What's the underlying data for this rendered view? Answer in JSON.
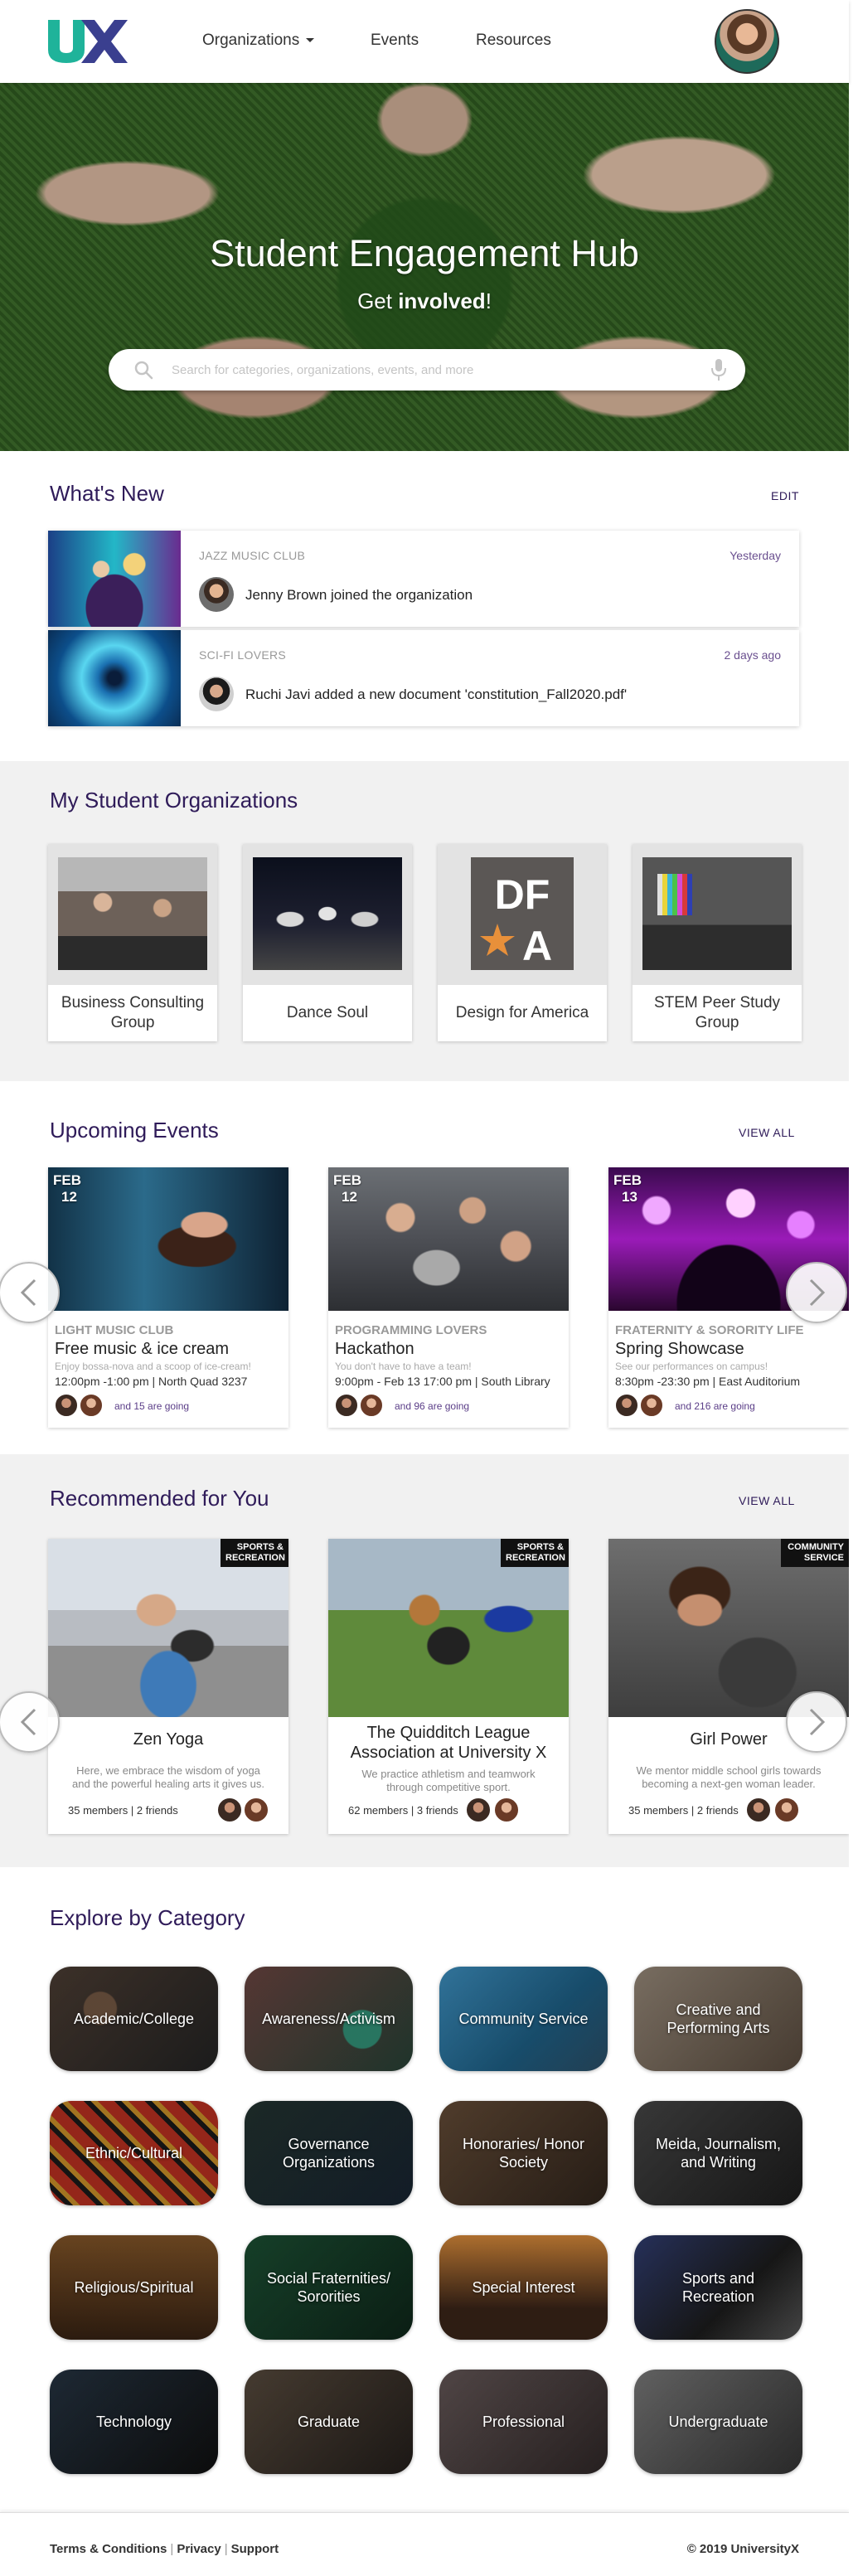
{
  "header": {
    "logo_text": "UX",
    "nav": {
      "organizations": "Organizations",
      "events": "Events",
      "resources": "Resources"
    }
  },
  "hero": {
    "title": "Student Engagement Hub",
    "subtitle_prefix": "Get ",
    "subtitle_bold": "involved",
    "subtitle_suffix": "!",
    "search_placeholder": "Search for categories, organizations, events, and more"
  },
  "whats_new": {
    "title": "What's New",
    "edit_label": "EDIT",
    "items": [
      {
        "club": "JAZZ MUSIC CLUB",
        "time": "Yesterday",
        "text": "Jenny Brown joined the organization"
      },
      {
        "club": "SCI-FI LOVERS",
        "time": "2 days ago",
        "text": "Ruchi Javi added a new document 'constitution_Fall2020.pdf'"
      }
    ]
  },
  "my_orgs": {
    "title": "My Student Organizations",
    "items": [
      {
        "name": "Business Consulting Group"
      },
      {
        "name": "Dance Soul"
      },
      {
        "name": "Design for America",
        "logo_text": "DF A"
      },
      {
        "name": "STEM Peer Study Group"
      }
    ]
  },
  "events": {
    "title": "Upcoming Events",
    "view_all": "VIEW ALL",
    "items": [
      {
        "month": "FEB",
        "day": "12",
        "club": "LIGHT MUSIC CLUB",
        "title": "Free music & ice cream",
        "desc": "Enjoy bossa-nova and a scoop of ice-cream!",
        "meta": "12:00pm -1:00 pm | North Quad 3237",
        "going": "and 15 are going"
      },
      {
        "month": "FEB",
        "day": "12",
        "club": "PROGRAMMING LOVERS",
        "title": "Hackathon",
        "desc": "You don't have to have a team!",
        "meta": "9:00pm - Feb 13 17:00 pm | South Library",
        "going": "and 96 are going"
      },
      {
        "month": "FEB",
        "day": "13",
        "club": "FRATERNITY & SORORITY LIFE",
        "title": "Spring Showcase",
        "desc": "See our performances on campus!",
        "meta": "8:30pm -23:30 pm | East Auditorium",
        "going": "and 216 are going"
      }
    ]
  },
  "recommended": {
    "title": "Recommended for You",
    "view_all": "VIEW ALL",
    "items": [
      {
        "tag_line1": "SPORTS &",
        "tag_line2": "RECREATION",
        "name": "Zen Yoga",
        "desc": "Here, we embrace the wisdom of yoga and the powerful healing arts it gives us.",
        "meta": "35 members | 2 friends"
      },
      {
        "tag_line1": "SPORTS &",
        "tag_line2": "RECREATION",
        "name": "The Quidditch League Association at University X",
        "desc": "We practice athletism and teamwork through competitive sport.",
        "meta": "62 members | 3 friends"
      },
      {
        "tag_line1": "COMMUNITY",
        "tag_line2": "SERVICE",
        "name": "Girl Power",
        "desc": "We mentor middle school girls towards becoming a next-gen woman leader.",
        "meta": "35 members | 2 friends"
      }
    ]
  },
  "categories": {
    "title": "Explore by Category",
    "items": [
      "Academic/College",
      "Awareness/Activism",
      "Community Service",
      "Creative and Performing Arts",
      "Ethnic/Cultural",
      "Governance Organizations",
      "Honoraries/ Honor Society",
      "Meida, Journalism, and Writing",
      "Religious/Spiritual",
      "Social Fraternities/ Sororities",
      "Special Interest",
      "Sports and Recreation",
      "Technology",
      "Graduate",
      "Professional",
      "Undergraduate"
    ]
  },
  "footer": {
    "terms": "Terms & Conditions",
    "privacy": "Privacy",
    "support": "Support",
    "copyright": "© 2019 UniversityX"
  },
  "colors": {
    "brand_purple": "#2f1b59",
    "logo_teal": "#1fb39a"
  }
}
